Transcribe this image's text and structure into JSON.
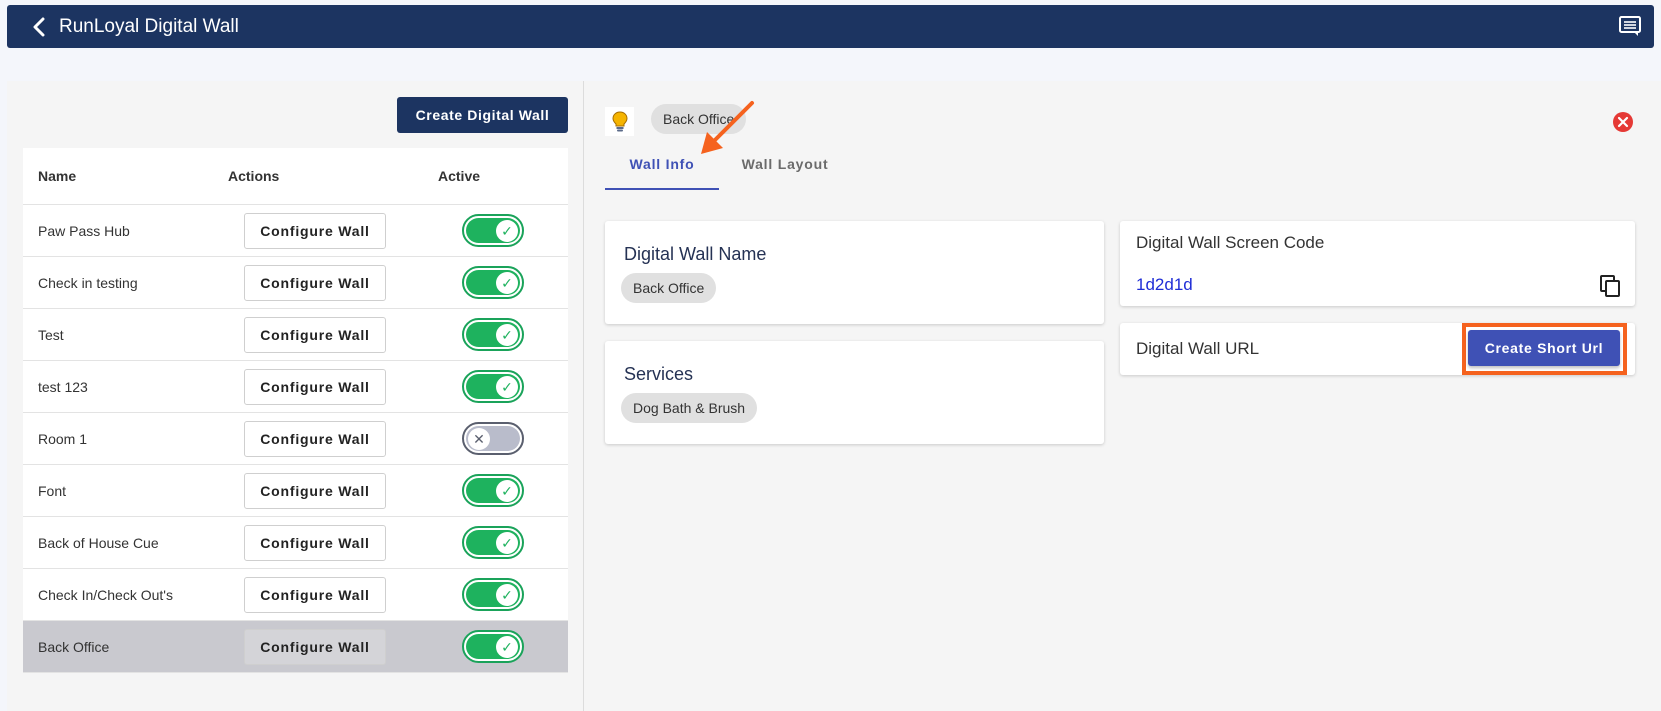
{
  "header": {
    "title": "RunLoyal Digital Wall"
  },
  "left": {
    "create_label": "Create Digital Wall",
    "columns": {
      "name": "Name",
      "actions": "Actions",
      "active": "Active"
    },
    "rows": [
      {
        "name": "Paw Pass Hub",
        "action": "Configure Wall",
        "active": true,
        "selected": false
      },
      {
        "name": "Check in testing",
        "action": "Configure Wall",
        "active": true,
        "selected": false
      },
      {
        "name": "Test",
        "action": "Configure Wall",
        "active": true,
        "selected": false
      },
      {
        "name": "test 123",
        "action": "Configure Wall",
        "active": true,
        "selected": false
      },
      {
        "name": "Room 1",
        "action": "Configure Wall",
        "active": false,
        "selected": false
      },
      {
        "name": "Font",
        "action": "Configure Wall",
        "active": true,
        "selected": false
      },
      {
        "name": "Back of House Cue",
        "action": "Configure Wall",
        "active": true,
        "selected": false
      },
      {
        "name": "Check In/Check Out's",
        "action": "Configure Wall",
        "active": true,
        "selected": false
      },
      {
        "name": "Back Office",
        "action": "Configure Wall",
        "active": true,
        "selected": true
      }
    ]
  },
  "detail": {
    "wall_chip": "Back Office",
    "tabs": [
      {
        "label": "Wall Info",
        "active": true
      },
      {
        "label": "Wall Layout",
        "active": false
      }
    ],
    "name_card": {
      "title": "Digital Wall Name",
      "value": "Back Office"
    },
    "services_card": {
      "title": "Services",
      "value": "Dog Bath & Brush"
    },
    "code_card": {
      "label": "Digital Wall Screen Code",
      "value": "1d2d1d"
    },
    "url_card": {
      "label": "Digital Wall URL",
      "button": "Create Short Url"
    }
  },
  "colors": {
    "brand": "#1c3461",
    "accent": "#3f51b5",
    "highlight": "#f5621e",
    "toggle_on": "#1eb25e"
  }
}
